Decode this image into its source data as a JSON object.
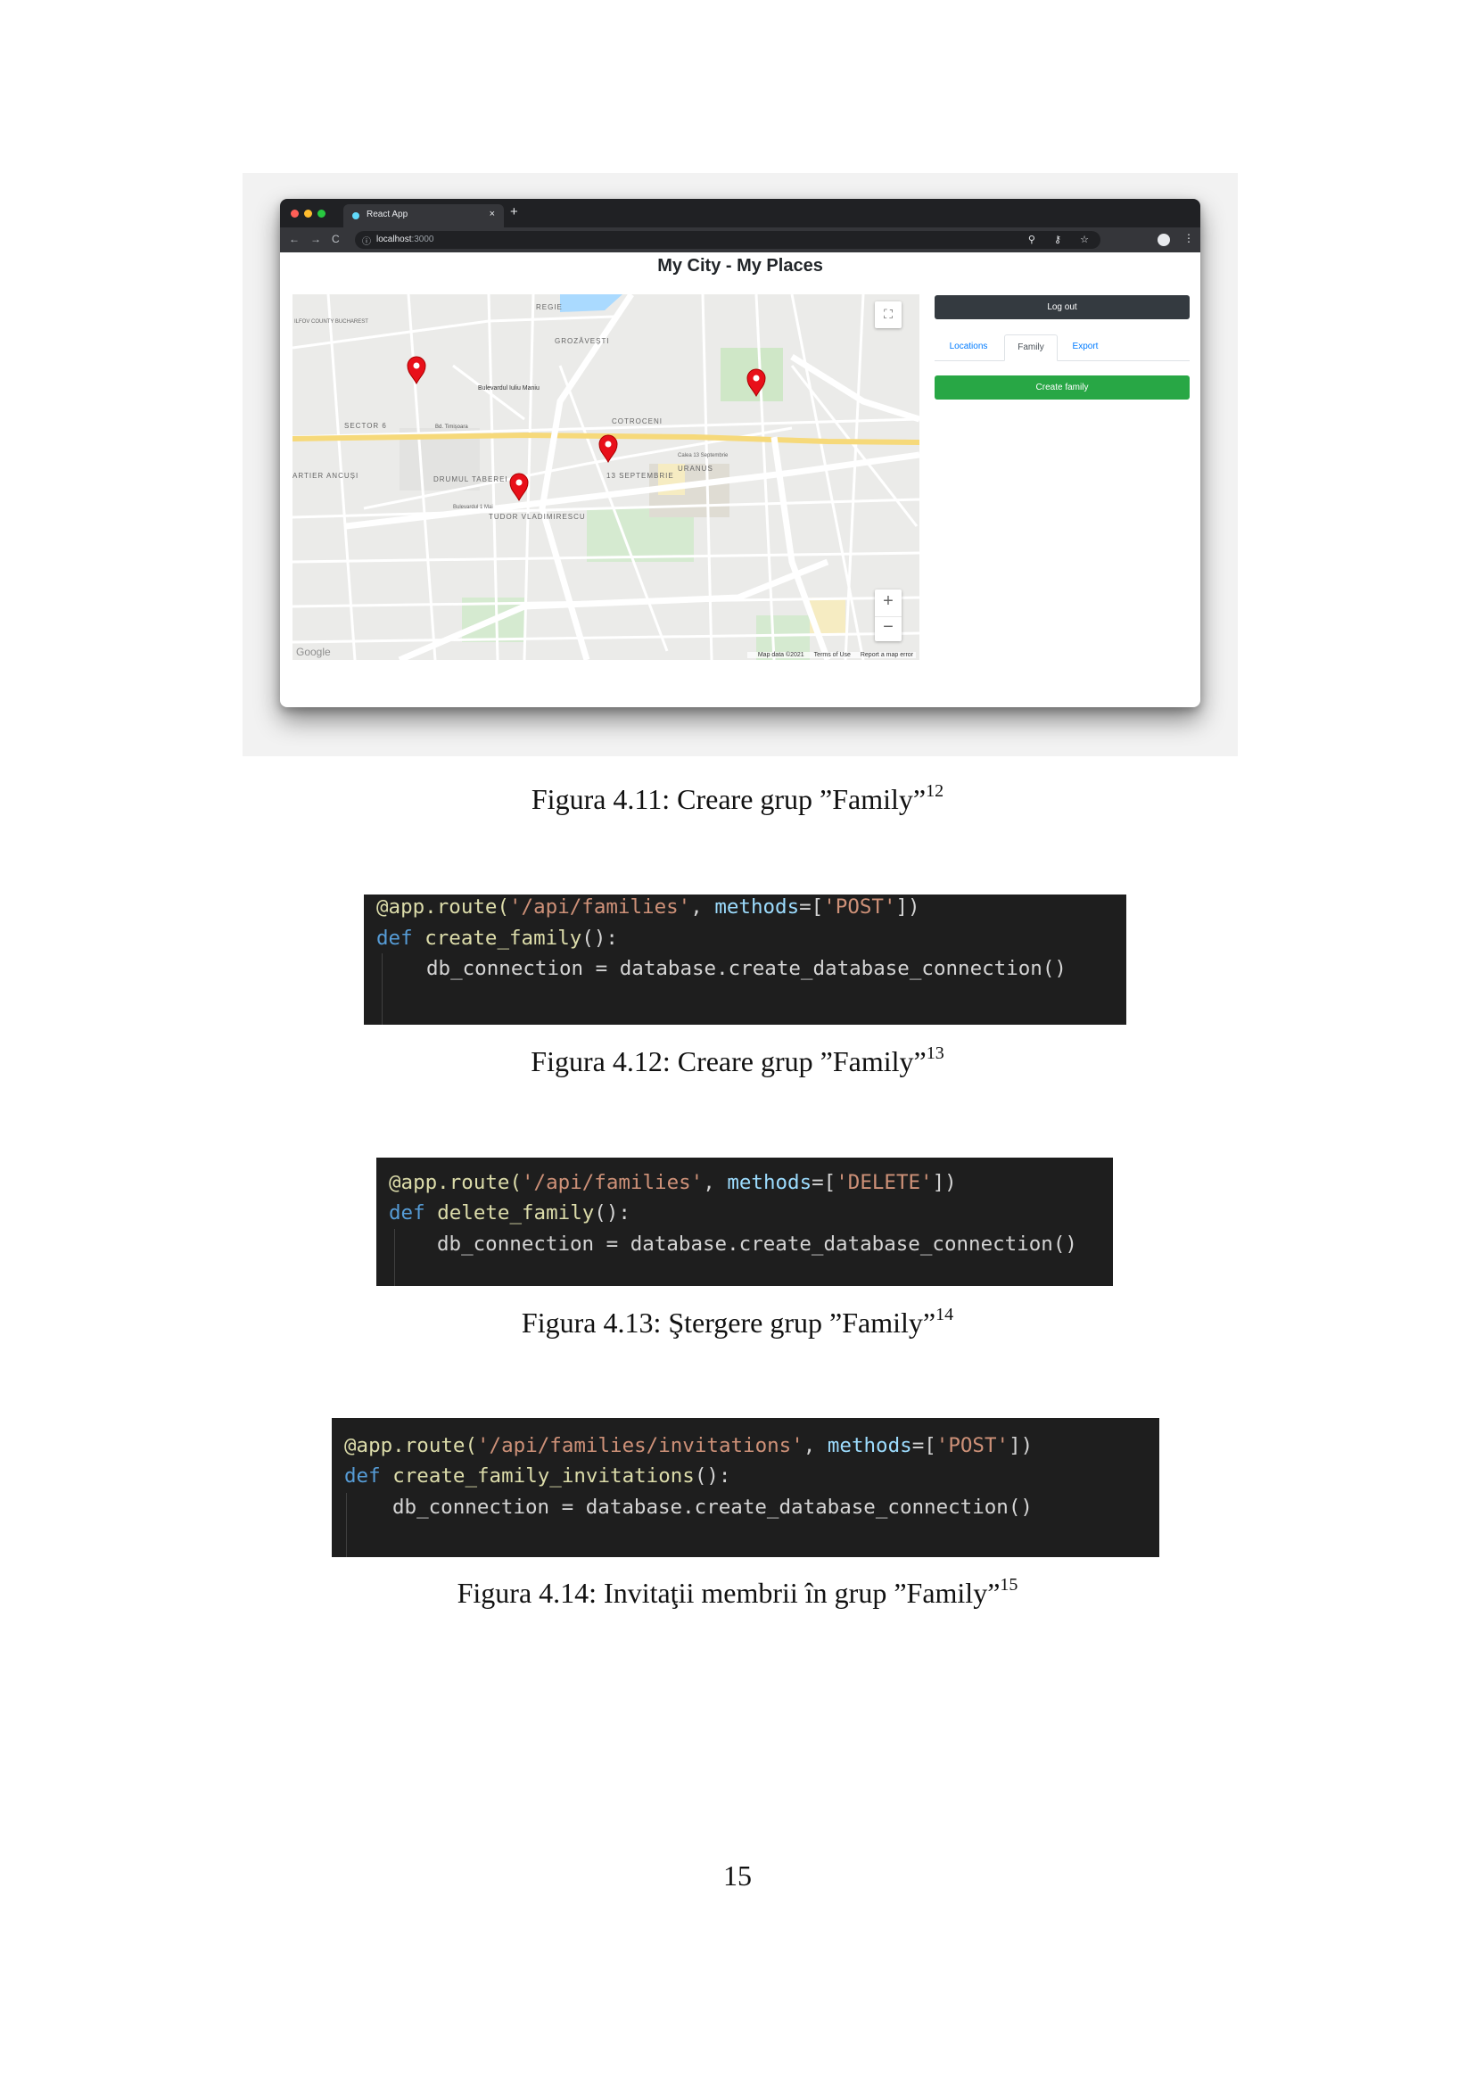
{
  "figure_4_11": {
    "browser": {
      "tab_title": "React App",
      "tab_close": "×",
      "new_tab": "+",
      "nav_back": "←",
      "nav_forward": "→",
      "nav_reload": "C",
      "info_icon": "ⓘ",
      "url_host": "localhost",
      "url_port": ":3000",
      "toolbar_icons": "⚲ ⚷ ☆",
      "menu_icon": "⋮"
    },
    "app": {
      "title": "My City - My Places",
      "logout_label": "Log out",
      "tabs": [
        "Locations",
        "Family",
        "Export"
      ],
      "active_tab": "Family",
      "create_family_label": "Create family"
    },
    "map": {
      "labels": [
        "REGIE",
        "GROZĂVEȘTI",
        "SECTOR 6",
        "Bulevardul Iuliu Maniu",
        "COTROCENI",
        "Bd. Timișoara",
        "DRUMUL TABEREI",
        "13 SEPTEMBRIE",
        "URANUS",
        "TUDOR VLADIMIRESCU",
        "ARTIER ANCUȘI",
        "ILFOV COUNTY BUCHAREST",
        "Calea 13 Septembrie",
        "Bulevardul 1 Mai"
      ],
      "markers": 4,
      "fullscreen_icon": "⛶",
      "zoom_in": "+",
      "zoom_out": "−",
      "google_logo": "Google",
      "footer": [
        "Map data ©2021",
        "Terms of Use",
        "Report a map error"
      ],
      "marker_color": "#e8101a"
    },
    "caption_text": "Figura 4.11: Creare grup ”Family”",
    "footnote": "12"
  },
  "figure_4_12": {
    "line1": {
      "decorator": "@app.route(",
      "path": "'/api/families'",
      "sep": ", ",
      "param": "methods",
      "eq": "=[",
      "method": "'POST'",
      "end": "])"
    },
    "line2": {
      "kw": "def ",
      "fn": "create_family",
      "rest": "():"
    },
    "line3": "db_connection = database.create_database_connection()",
    "caption_text": "Figura 4.12: Creare grup ”Family”",
    "footnote": "13"
  },
  "figure_4_13": {
    "line1": {
      "decorator": "@app.route(",
      "path": "'/api/families'",
      "sep": ", ",
      "param": "methods",
      "eq": "=[",
      "method": "'DELETE'",
      "end": "])"
    },
    "line2": {
      "kw": "def ",
      "fn": "delete_family",
      "rest": "():"
    },
    "line3": "db_connection = database.create_database_connection()",
    "caption_text": "Figura 4.13: Ştergere grup ”Family”",
    "footnote": "14"
  },
  "figure_4_14": {
    "line1": {
      "decorator": "@app.route(",
      "path": "'/api/families/invitations'",
      "sep": ", ",
      "param": "methods",
      "eq": "=[",
      "method": "'POST'",
      "end": "])"
    },
    "line2": {
      "kw": "def ",
      "fn": "create_family_invitations",
      "rest": "():"
    },
    "line3": "db_connection = database.create_database_connection()",
    "caption_text": "Figura 4.14: Invitaţii membrii în grup ”Family”",
    "footnote": "15"
  },
  "page_number": "15",
  "colors": {
    "code_bg": "#1e1e1e",
    "logout_bg": "#343a40",
    "create_family_bg": "#28a745",
    "tab_link": "#007bff"
  }
}
